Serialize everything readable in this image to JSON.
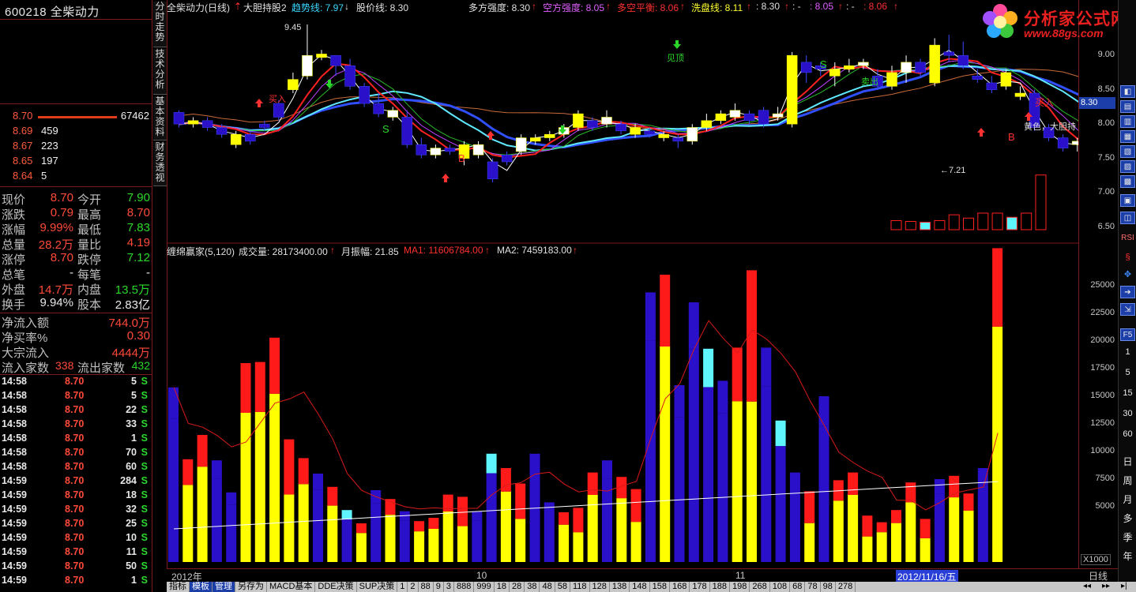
{
  "stock": {
    "code": "600218",
    "name": "全柴动力"
  },
  "orderbook": [
    {
      "price": "8.70",
      "vol": "67462",
      "bar": true
    },
    {
      "price": "8.69",
      "vol": "459"
    },
    {
      "price": "8.67",
      "vol": "223"
    },
    {
      "price": "8.65",
      "vol": "197"
    },
    {
      "price": "8.64",
      "vol": "5"
    }
  ],
  "stats": [
    {
      "l1": "现价",
      "v1": "8.70",
      "l2": "今开",
      "v2": "7.90",
      "c1": "red",
      "c2": "green"
    },
    {
      "l1": "涨跌",
      "v1": "0.79",
      "l2": "最高",
      "v2": "8.70",
      "c1": "red",
      "c2": "red"
    },
    {
      "l1": "涨幅",
      "v1": "9.99%",
      "l2": "最低",
      "v2": "7.83",
      "c1": "red",
      "c2": "green"
    },
    {
      "l1": "总量",
      "v1": "28.2万",
      "l2": "量比",
      "v2": "4.19",
      "c1": "red",
      "c2": "red"
    },
    {
      "l1": "涨停",
      "v1": "8.70",
      "l2": "跌停",
      "v2": "7.12",
      "c1": "red",
      "c2": "green"
    },
    {
      "l1": "总笔",
      "v1": "-",
      "l2": "每笔",
      "v2": "-",
      "c1": "white",
      "c2": "white"
    },
    {
      "l1": "外盘",
      "v1": "14.7万",
      "l2": "内盘",
      "v2": "13.5万",
      "c1": "red",
      "c2": "green"
    },
    {
      "l1": "换手",
      "v1": "9.94%",
      "l2": "股本",
      "v2": "2.83亿",
      "c1": "white",
      "c2": "white"
    }
  ],
  "flows": [
    {
      "label": "净流入额",
      "value": "744.0万"
    },
    {
      "label": "净买率%",
      "value": "0.30"
    },
    {
      "label": "大宗流入",
      "value": "4444万"
    }
  ],
  "flow_count": {
    "in_label": "流入家数",
    "in_value": "338",
    "out_label": "流出家数",
    "out_value": "432"
  },
  "ticks": [
    {
      "time": "14:58",
      "price": "8.70",
      "vol": "5",
      "side": "S"
    },
    {
      "time": "14:58",
      "price": "8.70",
      "vol": "5",
      "side": "S"
    },
    {
      "time": "14:58",
      "price": "8.70",
      "vol": "22",
      "side": "S"
    },
    {
      "time": "14:58",
      "price": "8.70",
      "vol": "33",
      "side": "S"
    },
    {
      "time": "14:58",
      "price": "8.70",
      "vol": "1",
      "side": "S"
    },
    {
      "time": "14:58",
      "price": "8.70",
      "vol": "70",
      "side": "S"
    },
    {
      "time": "14:58",
      "price": "8.70",
      "vol": "60",
      "side": "S"
    },
    {
      "time": "14:59",
      "price": "8.70",
      "vol": "284",
      "side": "S"
    },
    {
      "time": "14:59",
      "price": "8.70",
      "vol": "18",
      "side": "S"
    },
    {
      "time": "14:59",
      "price": "8.70",
      "vol": "32",
      "side": "S"
    },
    {
      "time": "14:59",
      "price": "8.70",
      "vol": "25",
      "side": "S"
    },
    {
      "time": "14:59",
      "price": "8.70",
      "vol": "10",
      "side": "S"
    },
    {
      "time": "14:59",
      "price": "8.70",
      "vol": "11",
      "side": "S"
    },
    {
      "time": "14:59",
      "price": "8.70",
      "vol": "50",
      "side": "S"
    },
    {
      "time": "14:59",
      "price": "8.70",
      "vol": "1",
      "side": "S"
    }
  ],
  "vtabs": [
    "分时走势",
    "技术分析",
    "基本资料",
    "财务透视"
  ],
  "upper_header": {
    "title": "全柴动力(日线)",
    "formula": "大胆持股2",
    "trend": "趋势线: 7.97",
    "price_line": "股价线: 8.30",
    "bull": "多方强度: 8.30",
    "bear": "空方强度: 8.05",
    "balance": "多空平衡: 8.06",
    "wash": "洗盘线: 8.11",
    "v1": ": 8.30",
    "v2": ": - ",
    "v3": ": 8.05",
    "v4": ": - ",
    "v5": ": 8.06"
  },
  "lower_header": {
    "name": "缠绵赢家(5,120)",
    "vol": "成交量: 28173400.00",
    "amp": "月振幅: 21.85",
    "ma1": "MA1: 11606784.00",
    "ma2": "MA2: 7459183.00"
  },
  "upper_axis": [
    "9.00",
    "8.50",
    "8.00",
    "7.50",
    "7.00",
    "6.50"
  ],
  "current_price_tag": "8.30",
  "lower_axis": [
    "25000",
    "22500",
    "20000",
    "17500",
    "15000",
    "12500",
    "10000",
    "7500",
    "5000"
  ],
  "lower_axis_unit": "X1000",
  "annotations": {
    "high": "9.45",
    "low": "←7.21",
    "buy1": "买入",
    "buy2": "买入",
    "sell": "卖出",
    "top": "见顶",
    "note": "黄色，大胆持",
    "b1": "B",
    "b2": "B",
    "s1": "S",
    "s2": "S"
  },
  "timeline": {
    "year": "2012年",
    "m10": "10",
    "m11": "11",
    "sel": "2012/11/16/五"
  },
  "period": "日线",
  "tabbar": [
    "指标",
    "模板",
    "管理",
    "另存为",
    "MACD基本",
    "DDE决策",
    "SUP决策",
    "1",
    "2",
    "88",
    "9",
    "3",
    "888",
    "999",
    "18",
    "28",
    "38",
    "48",
    "58",
    "118",
    "128",
    "138",
    "148",
    "158",
    "168",
    "178",
    "188",
    "198",
    "268",
    "108",
    "68",
    "78",
    "98",
    "278"
  ],
  "tools": [
    "RSI",
    "F5",
    "1",
    "5",
    "15",
    "30",
    "60",
    "日",
    "周",
    "月",
    "多",
    "季",
    "年"
  ],
  "logo": {
    "name": "分析家公式网",
    "url": "www.88gs.com"
  },
  "colors": {
    "up": "#ff2020",
    "down": "#2a10c8",
    "yellow": "#ffff00",
    "cyan": "#5ff5ff",
    "border": "#7a1a1a"
  },
  "chart_data": [
    {
      "type": "candlestick",
      "title": "全柴动力(日线)",
      "ylim": [
        6.3,
        9.6
      ],
      "ylabel": "",
      "candles": [
        [
          8.17,
          8.0,
          8.2,
          7.95
        ],
        [
          8.0,
          8.05,
          8.1,
          7.95
        ],
        [
          8.05,
          7.95,
          8.1,
          7.9
        ],
        [
          7.95,
          7.85,
          8.0,
          7.8
        ],
        [
          7.7,
          7.85,
          7.9,
          7.65
        ],
        [
          7.85,
          7.75,
          7.9,
          7.7
        ],
        [
          8.0,
          7.95,
          8.05,
          7.9
        ],
        [
          8.3,
          8.1,
          8.35,
          8.05
        ],
        [
          8.5,
          8.65,
          8.75,
          8.45
        ],
        [
          8.7,
          9.0,
          9.45,
          8.65
        ],
        [
          8.97,
          9.02,
          9.08,
          8.93
        ],
        [
          9.0,
          8.85,
          9.0,
          8.7
        ],
        [
          8.85,
          8.55,
          8.95,
          8.5
        ],
        [
          8.55,
          8.3,
          8.6,
          8.25
        ],
        [
          8.3,
          8.15,
          8.45,
          8.1
        ],
        [
          8.1,
          8.2,
          8.25,
          8.05
        ],
        [
          8.1,
          7.7,
          8.2,
          7.65
        ],
        [
          7.7,
          7.55,
          7.8,
          7.5
        ],
        [
          7.55,
          7.65,
          7.7,
          7.5
        ],
        [
          7.65,
          7.6,
          7.7,
          7.55
        ],
        [
          7.5,
          7.7,
          7.75,
          7.4
        ],
        [
          7.55,
          7.7,
          7.75,
          7.5
        ],
        [
          7.45,
          7.2,
          7.5,
          7.15
        ],
        [
          7.55,
          7.45,
          7.6,
          7.4
        ],
        [
          7.6,
          7.8,
          7.85,
          7.55
        ],
        [
          7.75,
          7.8,
          7.85,
          7.7
        ],
        [
          7.8,
          7.85,
          7.9,
          7.75
        ],
        [
          7.85,
          7.95,
          8.0,
          7.8
        ],
        [
          7.95,
          8.15,
          8.2,
          7.9
        ],
        [
          8.05,
          7.95,
          8.1,
          7.9
        ],
        [
          8.0,
          8.1,
          8.2,
          7.95
        ],
        [
          8.0,
          7.9,
          8.05,
          7.85
        ],
        [
          7.85,
          7.95,
          8.0,
          7.8
        ],
        [
          7.9,
          7.85,
          7.95,
          7.8
        ],
        [
          7.8,
          7.85,
          7.9,
          7.75
        ],
        [
          7.8,
          7.75,
          7.85,
          7.65
        ],
        [
          7.75,
          7.95,
          8.0,
          7.7
        ],
        [
          7.95,
          8.05,
          8.15,
          7.9
        ],
        [
          8.05,
          8.15,
          8.2,
          8.0
        ],
        [
          8.1,
          8.2,
          8.3,
          8.05
        ],
        [
          8.15,
          8.05,
          8.2,
          8.0
        ],
        [
          8.2,
          8.0,
          8.25,
          7.95
        ],
        [
          8.1,
          8.15,
          8.25,
          8.05
        ],
        [
          8.0,
          9.0,
          9.05,
          7.95
        ],
        [
          8.9,
          8.75,
          9.0,
          8.6
        ],
        [
          8.85,
          8.8,
          8.9,
          8.7
        ],
        [
          8.7,
          8.8,
          8.9,
          8.55
        ],
        [
          8.8,
          8.85,
          8.95,
          8.75
        ],
        [
          8.85,
          8.9,
          8.95,
          8.8
        ],
        [
          8.7,
          8.55,
          8.8,
          8.5
        ],
        [
          8.55,
          8.75,
          8.85,
          8.5
        ],
        [
          8.75,
          8.9,
          9.0,
          8.6
        ],
        [
          8.9,
          8.75,
          8.95,
          8.7
        ],
        [
          8.6,
          9.15,
          9.25,
          8.55
        ],
        [
          9.05,
          9.0,
          9.3,
          8.9
        ],
        [
          9.0,
          8.85,
          9.2,
          8.8
        ],
        [
          8.7,
          8.65,
          8.8,
          8.6
        ],
        [
          8.6,
          8.5,
          8.7,
          8.45
        ],
        [
          8.55,
          8.75,
          8.8,
          8.5
        ],
        [
          8.4,
          8.45,
          8.55,
          8.35
        ],
        [
          8.45,
          7.95,
          8.5,
          7.9
        ],
        [
          7.95,
          7.8,
          8.0,
          7.75
        ],
        [
          7.8,
          7.65,
          7.85,
          7.6
        ],
        [
          7.7,
          7.75,
          7.8,
          7.6
        ],
        [
          7.7,
          7.6,
          7.75,
          7.55
        ],
        [
          7.6,
          7.62,
          7.7,
          7.55
        ],
        [
          7.6,
          7.7,
          7.75,
          7.55
        ],
        [
          7.5,
          7.7,
          7.75,
          7.21
        ],
        [
          7.6,
          7.65,
          7.7,
          7.55
        ],
        [
          7.65,
          7.7,
          7.75,
          7.6
        ],
        [
          7.7,
          7.8,
          7.85,
          7.65
        ],
        [
          7.8,
          7.95,
          8.0,
          7.75
        ],
        [
          7.95,
          7.9,
          8.0,
          7.85
        ],
        [
          7.9,
          7.95,
          8.0,
          7.85
        ],
        [
          7.95,
          8.05,
          8.1,
          7.9
        ],
        [
          7.9,
          7.85,
          8.0,
          7.8
        ],
        [
          7.83,
          8.7,
          8.7,
          7.83
        ]
      ]
    },
    {
      "type": "bar",
      "title": "缠绵赢家(5,120)",
      "ylim": [
        0,
        28000
      ],
      "ylabel": "X1000",
      "values": [
        15800,
        9300,
        11500,
        9200,
        6300,
        18000,
        18100,
        20300,
        11100,
        9400,
        8000,
        6800,
        4700,
        3500,
        6500,
        5700,
        4600,
        3700,
        4000,
        6100,
        5900,
        4600,
        9800,
        8500,
        7100,
        9800,
        5400,
        4500,
        4900,
        8100,
        9200,
        7700,
        6600,
        24400,
        26000,
        16000,
        23500,
        19300,
        16400,
        19400,
        26400,
        19400,
        12800,
        8100,
        6400,
        15000,
        7400,
        8100,
        4200,
        3600,
        4700,
        7200,
        3900,
        7500,
        7800,
        6200,
        8500,
        28400
      ]
    }
  ]
}
